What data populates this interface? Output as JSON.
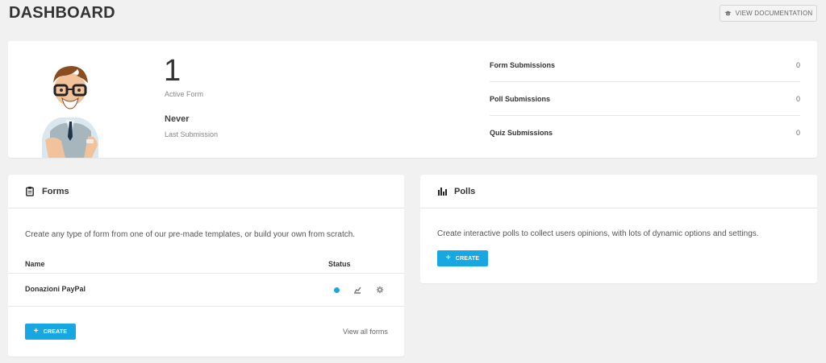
{
  "header": {
    "title": "DASHBOARD",
    "doc_button_label": "VIEW DOCUMENTATION"
  },
  "summary": {
    "active_form_count": "1",
    "active_form_label": "Active Form",
    "last_submission_value": "Never",
    "last_submission_label": "Last Submission",
    "submissions": [
      {
        "label": "Form Submissions",
        "count": "0"
      },
      {
        "label": "Poll Submissions",
        "count": "0"
      },
      {
        "label": "Quiz Submissions",
        "count": "0"
      }
    ]
  },
  "forms": {
    "title": "Forms",
    "description": "Create any type of form from one of our pre-made templates, or build your own from scratch.",
    "columns": {
      "name": "Name",
      "status": "Status"
    },
    "rows": [
      {
        "name": "Donazioni PayPal"
      }
    ],
    "create_label": "CREATE",
    "view_all_label": "View all forms"
  },
  "polls": {
    "title": "Polls",
    "description": "Create interactive polls to collect users opinions, with lots of dynamic options and settings.",
    "create_label": "CREATE"
  },
  "colors": {
    "accent": "#17a8e3",
    "background": "#f1f1f1"
  },
  "icons": {
    "doc": "graduation-cap-icon",
    "forms": "clipboard-icon",
    "polls": "bar-chart-icon",
    "status": "status-dot-icon",
    "submissions": "chart-icon",
    "settings": "gear-icon"
  }
}
